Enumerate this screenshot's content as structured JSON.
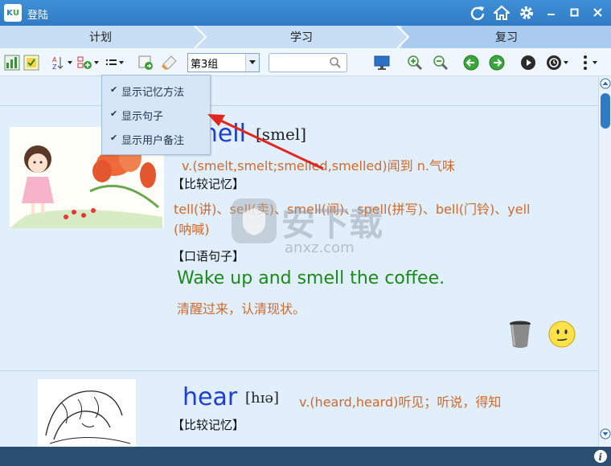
{
  "window": {
    "logo_text_k": "K",
    "logo_text_u": "U",
    "title": "登陆"
  },
  "tabs": [
    "计划",
    "学习",
    "复习"
  ],
  "toolbar": {
    "group_value": "第3组",
    "search_placeholder": ""
  },
  "menu": {
    "items": [
      {
        "label": "显示记忆方法",
        "checked": true
      },
      {
        "label": "显示句子",
        "checked": true
      },
      {
        "label": "显示用户备注",
        "checked": true
      }
    ]
  },
  "entries": [
    {
      "word": "smell",
      "phonetic": "[smel]",
      "definition": "v.(smelt,smelt;smelled,smelled)闻到 n.气味",
      "compare_heading": "【比较记忆】",
      "compare_text_line1": "tell(讲)、sell(卖)、smell(闻)、spell(拼写)、bell(门铃)、yell",
      "compare_text_line2": "(呐喊)",
      "sentence_heading": "【口语句子】",
      "sentence_en": "Wake up and smell the coffee.",
      "sentence_zh": "清醒过来，认清现状。"
    },
    {
      "word": "hear",
      "phonetic": "[hɪə]",
      "definition": "v.(heard,heard)听见；听说，得知",
      "compare_heading": "【比较记忆】"
    }
  ],
  "watermark": {
    "text_cn": "安下载",
    "text_en": "anxz.com"
  },
  "colors": {
    "title_bar": "#2f7cc4",
    "word_blue": "#1c3fcf",
    "definition_orange": "#d06a2c",
    "sentence_green": "#1a8a1a",
    "status_bar": "#2a4e72",
    "arrow_red": "#e0261e"
  }
}
